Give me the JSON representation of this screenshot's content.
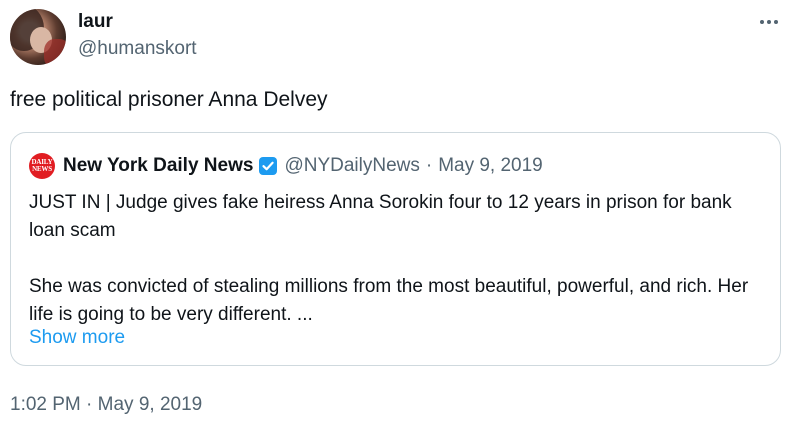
{
  "author": {
    "display_name": "laur",
    "handle": "@humanskort"
  },
  "tweet": {
    "text": "free political prisoner Anna Delvey",
    "timestamp": "1:02 PM · May 9, 2019"
  },
  "quoted_tweet": {
    "logo_text_top": "DAILY",
    "logo_text_bottom": "NEWS",
    "display_name": "New York Daily News",
    "verified": true,
    "handle": "@NYDailyNews",
    "separator": "·",
    "date": "May 9, 2019",
    "paragraph_1": "JUST IN | Judge gives fake heiress Anna Sorokin four to 12 years in prison for bank loan scam",
    "paragraph_2": "She was convicted of stealing millions from the most beautiful, powerful, and rich. Her life is going to be very different. ...",
    "show_more_label": "Show more"
  },
  "colors": {
    "text_primary": "#0f1419",
    "text_secondary": "#536471",
    "link": "#1d9bf0",
    "border": "#cfd9de",
    "verified": "#1d9bf0",
    "daily_news_red": "#e11d22"
  }
}
